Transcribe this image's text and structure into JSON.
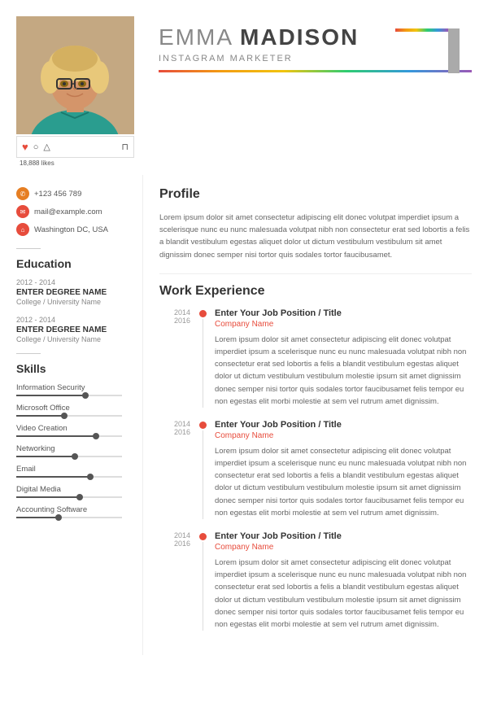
{
  "header": {
    "first_name": "EMMA",
    "last_name": "MADISON",
    "job_title": "INSTAGRAM MARKETER",
    "likes": "18,888 likes"
  },
  "contact": {
    "phone": "+123 456 789",
    "email": "mail@example.com",
    "location": "Washington DC, USA"
  },
  "profile": {
    "title": "Profile",
    "text": "Lorem ipsum dolor sit amet consectetur adipiscing elit donec volutpat imperdiet ipsum a scelerisque nunc eu nunc malesuada volutpat nibh non consectetur erat sed lobortis a felis a blandit vestibulum egestas aliquet dolor ut dictum vestibulum vestibulum sit amet dignissim donec semper nisi tortor quis sodales tortor faucibusamet."
  },
  "education": {
    "title": "Education",
    "items": [
      {
        "years": "2012 - 2014",
        "degree": "ENTER DEGREE NAME",
        "school": "College / University Name"
      },
      {
        "years": "2012 - 2014",
        "degree": "ENTER DEGREE NAME",
        "school": "College / University Name"
      }
    ]
  },
  "skills": {
    "title": "Skills",
    "items": [
      {
        "name": "Information Security",
        "level": 65
      },
      {
        "name": "Microsoft Office",
        "level": 45
      },
      {
        "name": "Video Creation",
        "level": 75
      },
      {
        "name": "Networking",
        "level": 55
      },
      {
        "name": "Email",
        "level": 70
      },
      {
        "name": "Digital Media",
        "level": 60
      },
      {
        "name": "Accounting Software",
        "level": 40
      }
    ]
  },
  "work": {
    "title": "Work Experience",
    "entries": [
      {
        "year_start": "2014",
        "year_end": "2016",
        "title": "Enter Your Job Position / Title",
        "company": "Company Name",
        "desc": "Lorem ipsum dolor sit amet consectetur adipiscing elit donec volutpat imperdiet ipsum a scelerisque nunc eu nunc malesuada volutpat nibh non consectetur erat sed lobortis a felis a blandit vestibulum egestas aliquet dolor ut dictum vestibulum vestibulum molestie ipsum sit amet dignissim donec semper nisi tortor quis sodales tortor faucibusamet felis tempor eu non egestas elit morbi molestie at sem vel rutrum amet dignissim."
      },
      {
        "year_start": "2014",
        "year_end": "2016",
        "title": "Enter Your Job Position / Title",
        "company": "Company Name",
        "desc": "Lorem ipsum dolor sit amet consectetur adipiscing elit donec volutpat imperdiet ipsum a scelerisque nunc eu nunc malesuada volutpat nibh non consectetur erat sed lobortis a felis a blandit vestibulum egestas aliquet dolor ut dictum vestibulum vestibulum molestie ipsum sit amet dignissim donec semper nisi tortor quis sodales tortor faucibusamet felis tempor eu non egestas elit morbi molestie at sem vel rutrum amet dignissim."
      },
      {
        "year_start": "2014",
        "year_end": "2016",
        "title": "Enter Your Job Position / Title",
        "company": "Company Name",
        "desc": "Lorem ipsum dolor sit amet consectetur adipiscing elit donec volutpat imperdiet ipsum a scelerisque nunc eu nunc malesuada volutpat nibh non consectetur erat sed lobortis a felis a blandit vestibulum egestas aliquet dolor ut dictum vestibulum vestibulum molestie ipsum sit amet dignissim donec semper nisi tortor quis sodales tortor faucibusamet felis tempor eu non egestas elit morbi molestie at sem vel rutrum amet dignissim."
      }
    ]
  }
}
